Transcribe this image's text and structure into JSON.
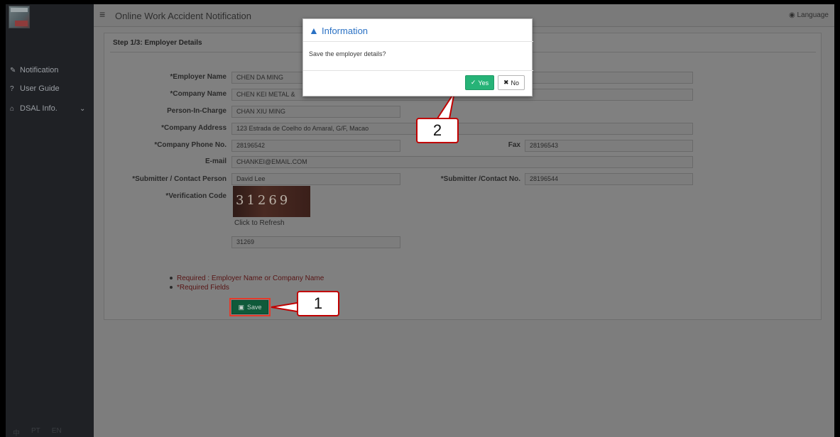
{
  "sidebar": {
    "items": [
      {
        "icon": "edit-icon",
        "glyph": "✎",
        "label": "Notification"
      },
      {
        "icon": "question-icon",
        "glyph": "?",
        "label": "User Guide"
      },
      {
        "icon": "home-icon",
        "glyph": "⌂",
        "label": "DSAL Info."
      }
    ],
    "languages": [
      "中",
      "PT",
      "EN"
    ]
  },
  "header": {
    "title": "Online Work Accident Notification",
    "language": "Language"
  },
  "form": {
    "step_title": "Step 1/3: Employer Details",
    "labels": {
      "employer_name": "*Employer Name",
      "company_name": "*Company Name",
      "person_in_charge": "Person-In-Charge",
      "company_address": "*Company Address",
      "company_phone": "*Company Phone No.",
      "fax": "Fax",
      "email": "E-mail",
      "submitter": "*Submitter / Contact Person",
      "submitter_no": "*Submitter /Contact No.",
      "verification": "*Verification Code"
    },
    "values": {
      "employer_name": "CHEN DA MING",
      "company_name": "CHEN KEI METAL &",
      "person_in_charge": "CHAN XIU MING",
      "company_address": "123 Estrada de Coelho do Amaral, G/F, Macao",
      "company_phone": "28196542",
      "fax": "28196543",
      "email": "CHANKEI@EMAIL.COM",
      "submitter": "David Lee",
      "submitter_no": "28196544",
      "verification": "31269"
    },
    "captcha_text": "31269",
    "refresh": "Click to Refresh",
    "notes": [
      "Required : Employer Name or Company Name",
      "*Required Fields"
    ],
    "save": "Save"
  },
  "modal": {
    "title": "Information",
    "message": "Save the employer details?",
    "yes": "Yes",
    "no": "No"
  },
  "callouts": {
    "first": "1",
    "second": "2"
  },
  "colors": {
    "accent_red": "#c00000",
    "yes_green": "#26b377",
    "save_green": "#0f5a3a",
    "info_blue": "#2a71c4"
  }
}
